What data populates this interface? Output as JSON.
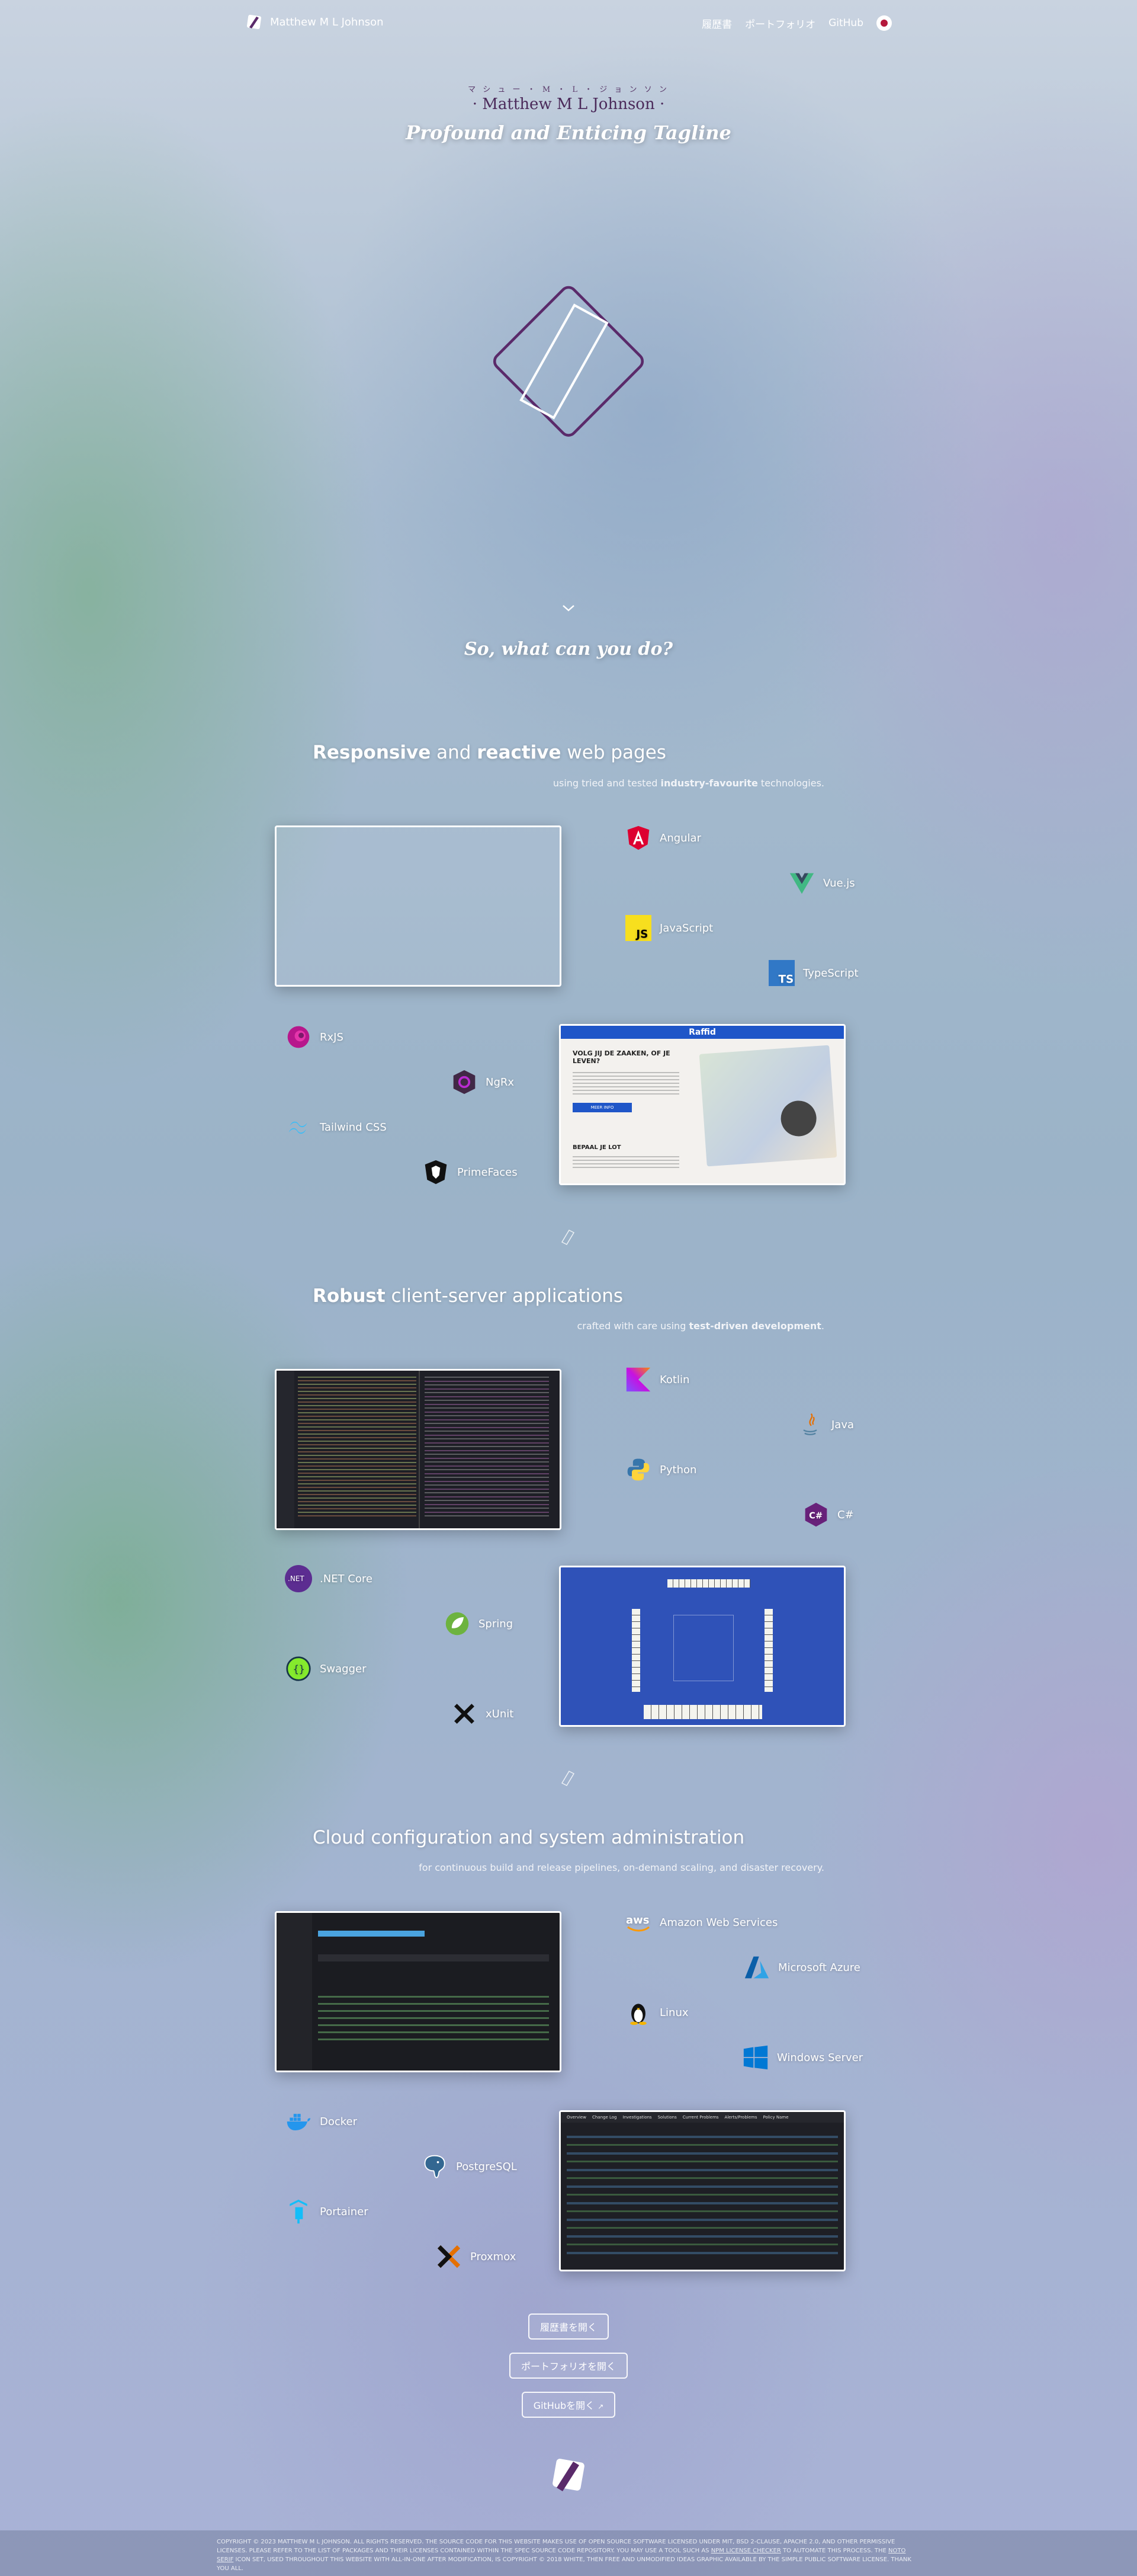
{
  "nav": {
    "brand": "Matthew M L Johnson",
    "links": [
      "履歴書",
      "ポートフォリオ",
      "GitHub"
    ]
  },
  "hero": {
    "furigana": "マ シ ュ ー ・ M ・ L ・ ジ ョ ン ソ ン",
    "name": "· Matthew M L Johnson ·",
    "tagline": "Profound and Enticing Tagline",
    "question": "So, what can you do?"
  },
  "sections": [
    {
      "title_parts": [
        "Responsive",
        " and ",
        "reactive",
        " web pages"
      ],
      "subtitle_parts": [
        "using tried and tested ",
        "industry-favourite",
        " technologies."
      ],
      "techs": [
        "Angular",
        "Vue.js",
        "JavaScript",
        "TypeScript",
        "RxJS",
        "NgRx",
        "Tailwind CSS",
        "PrimeFaces"
      ]
    },
    {
      "title_parts": [
        "Robust",
        " client-server applications"
      ],
      "subtitle_parts": [
        "crafted with care using ",
        "test-driven development",
        "."
      ],
      "techs": [
        "Kotlin",
        "Java",
        "Python",
        "C#",
        ".NET Core",
        "Spring",
        "Swagger",
        "xUnit"
      ]
    },
    {
      "title_parts": [
        "Cloud configuration and system administration"
      ],
      "subtitle_parts": [
        "for continuous build and release pipelines, on-demand scaling, and disaster recovery."
      ],
      "techs": [
        "Amazon Web Services",
        "Microsoft Azure",
        "Linux",
        "Windows Server",
        "Docker",
        "PostgreSQL",
        "Portainer",
        "Proxmox"
      ]
    }
  ],
  "raffid": {
    "logo": "Raffid",
    "heading": "VOLG JIJ DE ZAAKEN, OF JE LEVEN?",
    "heading2": "BEPAAL JE LOT",
    "cta": "MEER INFO"
  },
  "dark_table": {
    "tabs": [
      "Overview",
      "Change Log",
      "Investigations",
      "Solutions",
      "Current Problems",
      "Alerts/Problems",
      "Policy Name"
    ]
  },
  "buttons": {
    "resume": "履歴書を開く",
    "portfolio": "ポートフォリオを開く",
    "github": "GitHubを開く"
  },
  "footer": {
    "text_before": "COPYRIGHT © 2023 MATTHEW M L JOHNSON. ALL RIGHTS RESERVED. THE SOURCE CODE FOR THIS WEBSITE MAKES USE OF OPEN SOURCE SOFTWARE LICENSED UNDER MIT, BSD 2-CLAUSE, APACHE 2.0, AND OTHER PERMISSIVE LICENSES. PLEASE REFER TO THE LIST OF PACKAGES AND THEIR LICENSES CONTAINED WITHIN THE SPEC SOURCE CODE REPOSITORY. YOU MAY USE A TOOL SUCH AS ",
    "link1": "NPM LICENSE CHECKER",
    "text_middle": " TO AUTOMATE THIS PROCESS. THE ",
    "link2": "NOTO SERIF",
    "text_after": " ICON SET, USED THROUGHOUT THIS WEBSITE WITH ALL-IN-ONE AFTER MODIFICATION, IS COPYRIGHT © 2018 WHITE, THEN FREE AND UNMODIFIED IDEAS GRAPHIC AVAILABLE BY THE SIMPLE PUBLIC SOFTWARE LICENSE. THANK YOU ALL."
  }
}
